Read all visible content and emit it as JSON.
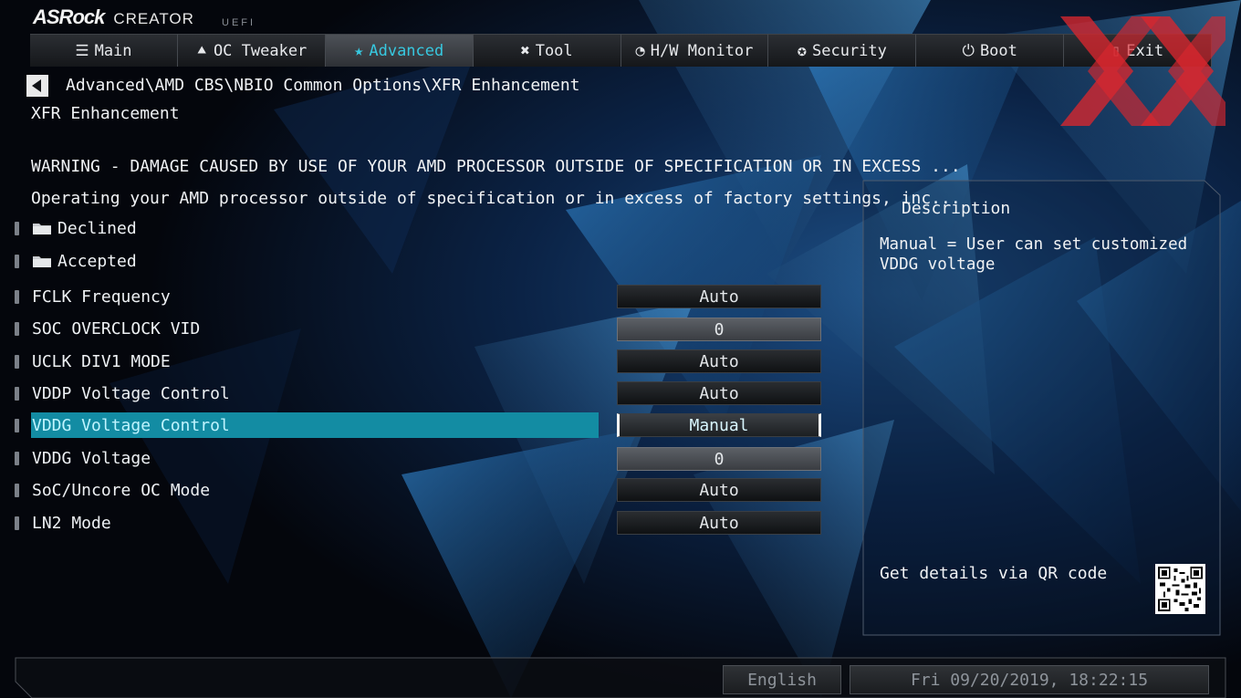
{
  "brand": {
    "name": "ASRock",
    "series": "CREATOR",
    "uefi": "UEFI"
  },
  "tabs": [
    {
      "label": "Main",
      "icon": "list-icon"
    },
    {
      "label": "OC Tweaker",
      "icon": "rocket-icon"
    },
    {
      "label": "Advanced",
      "icon": "star-icon",
      "active": true
    },
    {
      "label": "Tool",
      "icon": "tools-icon"
    },
    {
      "label": "H/W Monitor",
      "icon": "monitor-icon"
    },
    {
      "label": "Security",
      "icon": "shield-icon"
    },
    {
      "label": "Boot",
      "icon": "power-icon"
    },
    {
      "label": "Exit",
      "icon": "exit-icon"
    }
  ],
  "breadcrumb": "Advanced\\AMD CBS\\NBIO Common Options\\XFR Enhancement",
  "page_title": "XFR Enhancement",
  "warning": {
    "line1": "WARNING - DAMAGE CAUSED BY USE OF YOUR AMD PROCESSOR OUTSIDE OF SPECIFICATION OR IN EXCESS ...",
    "line2": "Operating your AMD processor outside of specification or in excess of factory settings, inc..."
  },
  "folders": [
    {
      "label": "Declined"
    },
    {
      "label": "Accepted"
    }
  ],
  "settings": [
    {
      "label": "FCLK Frequency",
      "value": "Auto"
    },
    {
      "label": "SOC OVERCLOCK VID",
      "value": "0"
    },
    {
      "label": "UCLK DIV1 MODE",
      "value": "Auto"
    },
    {
      "label": "VDDP Voltage Control",
      "value": "Auto"
    },
    {
      "label": "VDDG Voltage Control",
      "value": "Manual"
    },
    {
      "label": "VDDG Voltage",
      "value": "0"
    },
    {
      "label": "SoC/Uncore OC Mode",
      "value": "Auto"
    },
    {
      "label": "LN2 Mode",
      "value": "Auto"
    }
  ],
  "description": {
    "title": "Description",
    "text": "Manual = User can set customized VDDG voltage",
    "qr_label": "Get details via QR code"
  },
  "footer": {
    "language": "English",
    "datetime": "Fri 09/20/2019, 18:22:15"
  },
  "colors": {
    "accent": "#37c8e0",
    "selection": "#138ca3",
    "watermark": "#d8262e"
  }
}
